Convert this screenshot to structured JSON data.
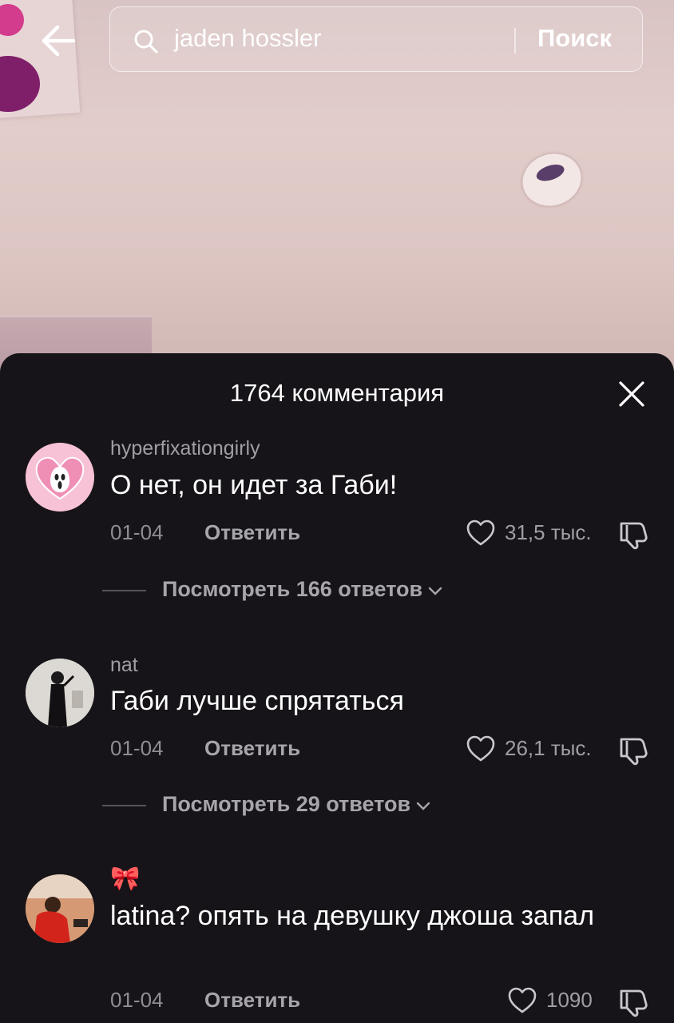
{
  "search": {
    "query": "jaden hossler",
    "submit_label": "Поиск"
  },
  "comments_panel": {
    "title": "1764 комментария",
    "comments": [
      {
        "username": "hyperfixationgirly",
        "text": "О нет, он идет за Габи!",
        "date": "01-04",
        "reply_label": "Ответить",
        "likes": "31,5 тыс.",
        "replies_label": "Посмотреть 166 ответов"
      },
      {
        "username": "nat",
        "text": "Габи лучше спрятаться",
        "date": "01-04",
        "reply_label": "Ответить",
        "likes": "26,1 тыс.",
        "replies_label": "Посмотреть 29 ответов"
      },
      {
        "username": "🎀",
        "text": "latina? опять на девушку джоша запал",
        "date": "01-04",
        "reply_label": "Ответить",
        "likes": "1090"
      }
    ]
  },
  "icons": {
    "back": "arrow-left-icon",
    "search": "search-icon",
    "close": "close-icon",
    "like": "heart-icon",
    "dislike": "thumbs-down-icon",
    "expand": "chevron-down-icon"
  },
  "colors": {
    "panel_bg": "#161418",
    "text_primary": "#ffffff",
    "text_secondary": "#a09ea5",
    "avatar_pink": "#f6b8cf"
  }
}
